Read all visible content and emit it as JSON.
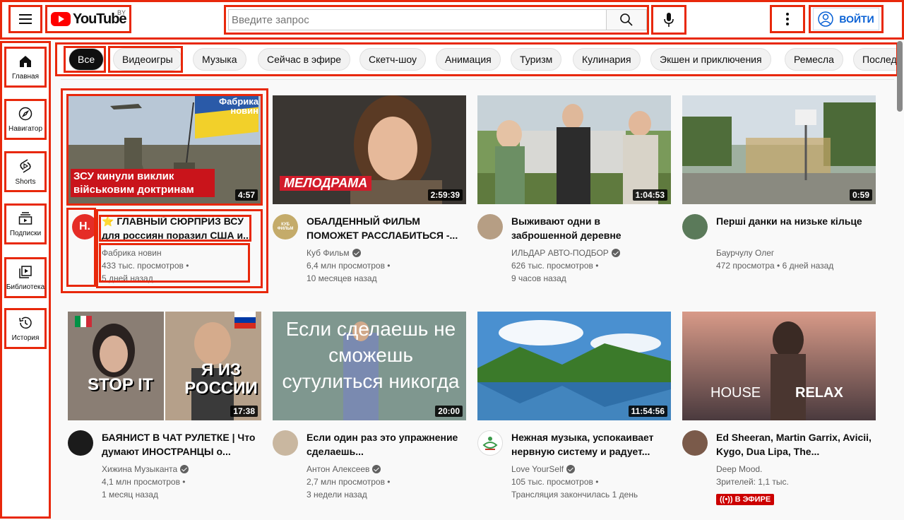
{
  "header": {
    "logo_text": "YouTube",
    "country": "BY",
    "search_placeholder": "Введите запрос",
    "signin_label": "ВОЙТИ"
  },
  "sidebar": {
    "items": [
      {
        "label": "Главная",
        "icon": "home-icon"
      },
      {
        "label": "Навигатор",
        "icon": "compass-icon"
      },
      {
        "label": "Shorts",
        "icon": "shorts-icon"
      },
      {
        "label": "Подписки",
        "icon": "subscriptions-icon"
      },
      {
        "label": "Библиотека",
        "icon": "library-icon"
      },
      {
        "label": "История",
        "icon": "history-icon"
      }
    ]
  },
  "chips": [
    "Все",
    "Видеоигры",
    "Музыка",
    "Сейчас в эфире",
    "Скетч-шоу",
    "Анимация",
    "Туризм",
    "Кулинария",
    "Экшен и приключения",
    "Ремесла",
    "Последние"
  ],
  "videos": [
    {
      "title": "⭐ ГЛАВНЫЙ СЮРПРИЗ ВСУ для россиян поразил США и...",
      "channel": "Фабрика новин",
      "views": "433 тыс. просмотров",
      "age": "5 дней назад",
      "duration": "4:57",
      "verified": false,
      "thumb_text": "ЗСУ кинули виклик військовим доктринам",
      "thumb_brand": "Фабрика новин",
      "avatar_text": "Н."
    },
    {
      "title": "ОБАЛДЕННЫЙ ФИЛЬМ ПОМОЖЕТ РАССЛАБИТЬСЯ -...",
      "channel": "Куб Фильм",
      "views": "6,4 млн просмотров",
      "age": "10 месяцев назад",
      "duration": "2:59:39",
      "verified": true,
      "thumb_text": "МЕЛОДРАМА",
      "avatar_text": "КУБ ФИЛЬМ"
    },
    {
      "title": "Выживают одни в заброшенной деревне",
      "channel": "ИЛЬДАР АВТО-ПОДБОР",
      "views": "626 тыс. просмотров",
      "age": "9 часов назад",
      "duration": "1:04:53",
      "verified": true
    },
    {
      "title": "Перші данки на низьке кільце",
      "channel": "Баурчулу Олег",
      "views": "472 просмотра",
      "age": "6 дней назад",
      "duration": "0:59",
      "verified": false
    },
    {
      "title": "БАЯНИСТ В ЧАТ РУЛЕТКЕ | Что думают ИНОСТРАНЦЫ о...",
      "channel": "Хижина Музыканта",
      "views": "4,1 млн просмотров",
      "age": "1 месяц назад",
      "duration": "17:38",
      "verified": true,
      "thumb_text_left": "STOP IT",
      "thumb_text_right": "Я ИЗ РОССИИ"
    },
    {
      "title": "Если один раз это упражнение сделаешь...",
      "channel": "Антон Алексеев",
      "views": "2,7 млн просмотров",
      "age": "3 недели назад",
      "duration": "20:00",
      "verified": true,
      "thumb_text": "Если сделаешь не сможешь сутулиться никогда"
    },
    {
      "title": "Нежная музыка, успокаивает нервную систему и радует...",
      "channel": "Love YourSelf",
      "views": "105 тыс. просмотров",
      "age": "Трансляция закончилась 1 день",
      "duration": "11:54:56",
      "verified": true
    },
    {
      "title": "Ed Sheeran, Martin Garrix, Avicii, Kygo, Dua Lipa, The...",
      "channel": "Deep Mood.",
      "views": "Зрителей: 1,1 тыс.",
      "age": "",
      "duration": "",
      "verified": false,
      "live_label": "В ЭФИРЕ",
      "thumb_text_left": "HOUSE",
      "thumb_text_right": "RELAX"
    }
  ]
}
